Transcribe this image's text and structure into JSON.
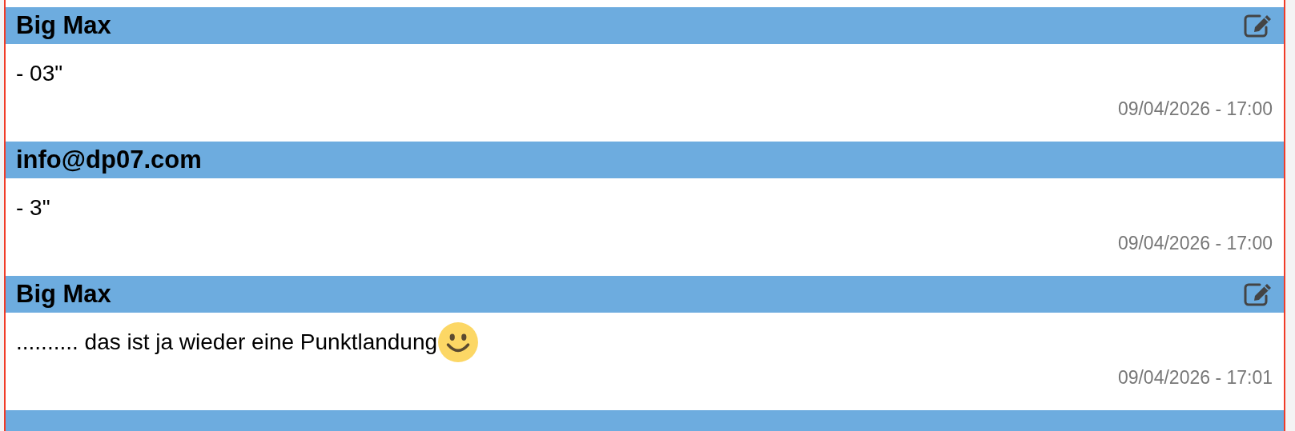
{
  "messages": [
    {
      "author": "Big Max",
      "editable": true,
      "text": "- 03\"",
      "smiley": false,
      "time": "09/04/2026 - 17:00"
    },
    {
      "author": "info@dp07.com",
      "editable": false,
      "text": "- 3\"",
      "smiley": false,
      "time": "09/04/2026 - 17:00"
    },
    {
      "author": "Big Max",
      "editable": true,
      "text": ".......... das ist ja wieder eine Punktlandung",
      "smiley": true,
      "time": "09/04/2026 - 17:01"
    }
  ]
}
